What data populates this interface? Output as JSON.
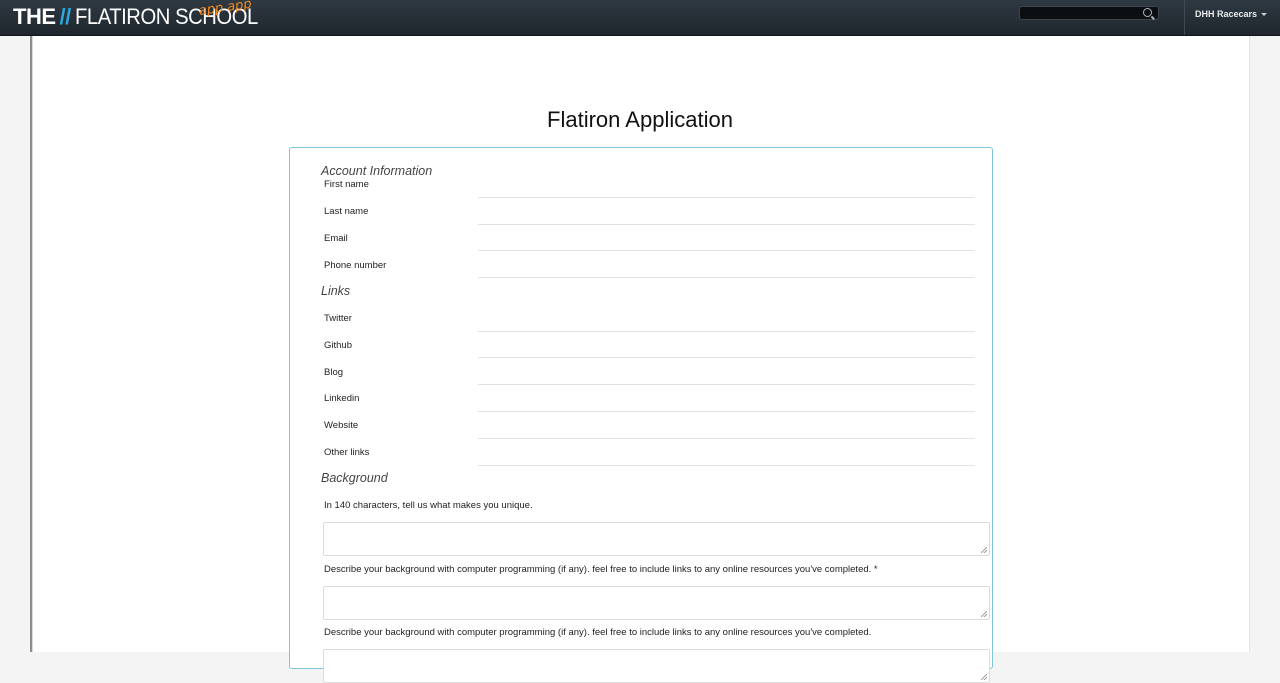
{
  "header": {
    "logo_the": "THE",
    "logo_slashes": "//",
    "logo_school": "FLATIRON SCHOOL",
    "app_tag": "app app",
    "search_placeholder": "",
    "user_menu_label": "DHH Racecars"
  },
  "main": {
    "title": "Flatiron Application",
    "sections": {
      "account": "Account Information",
      "links": "Links",
      "background": "Background"
    },
    "account_fields": [
      "First name",
      "Last name",
      "Email",
      "Phone number"
    ],
    "link_fields": [
      "Twitter",
      "Github",
      "Blog",
      "Linkedin",
      "Website",
      "Other links"
    ],
    "background_questions": [
      "In 140 characters, tell us what makes you unique.",
      "Describe your background with computer programming (if any). feel free to include links to any online resources you've completed. *",
      "Describe your background with computer programming (if any). feel free to include links to any online resources you've completed."
    ]
  },
  "colors": {
    "topbar": "#26303a",
    "accent_blue": "#2ba6de",
    "app_tag_orange": "#f28a1b",
    "form_border": "#7fc4dd"
  }
}
